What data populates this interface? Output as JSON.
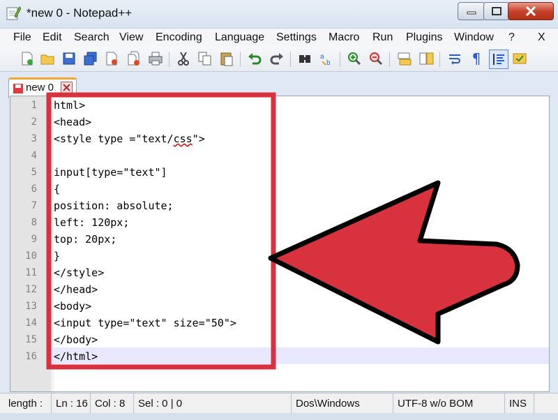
{
  "window": {
    "title": "*new  0 - Notepad++"
  },
  "menu": [
    "File",
    "Edit",
    "Search",
    "View",
    "Encoding",
    "Language",
    "Settings",
    "Macro",
    "Run",
    "Plugins",
    "Window",
    "?",
    "X"
  ],
  "toolbar_icons": [
    "new-file-icon",
    "open-file-icon",
    "save-icon",
    "save-all-icon",
    "close-icon",
    "close-all-icon",
    "print-icon",
    "cut-icon",
    "copy-icon",
    "paste-icon",
    "undo-icon",
    "redo-icon",
    "find-icon",
    "replace-icon",
    "zoom-in-icon",
    "zoom-out-icon",
    "sync-vertical-icon",
    "sync-horizontal-icon",
    "word-wrap-icon",
    "show-all-characters-icon",
    "indent-guide-icon",
    "user-defined-language-icon"
  ],
  "tab": {
    "label": "new  0"
  },
  "editor": {
    "line_numbers": [
      "1",
      "2",
      "3",
      "4",
      "5",
      "6",
      "7",
      "8",
      "9",
      "10",
      "11",
      "12",
      "13",
      "14",
      "15",
      "16"
    ],
    "lines": [
      "html>",
      "<head>",
      "<style type =\"text/css\">",
      "",
      "input[type=\"text\"]",
      "{",
      "position: absolute;",
      "left: 120px;",
      "top: 20px;",
      "}",
      "</style>",
      "</head>",
      "<body>",
      "<input type=\"text\" size=\"50\">",
      "</body>",
      "</html>"
    ],
    "current_line": 16
  },
  "status": {
    "length": "length :",
    "ln": "Ln : 16",
    "col": "Col : 8",
    "sel": "Sel : 0 | 0",
    "eol": "Dos\\Windows",
    "encoding": "UTF-8 w/o BOM",
    "mode": "INS"
  },
  "colors": {
    "annotation_red": "#d9323f",
    "current_line_bg": "#e8e8ff",
    "gutter_bg": "#e4e4e4"
  }
}
